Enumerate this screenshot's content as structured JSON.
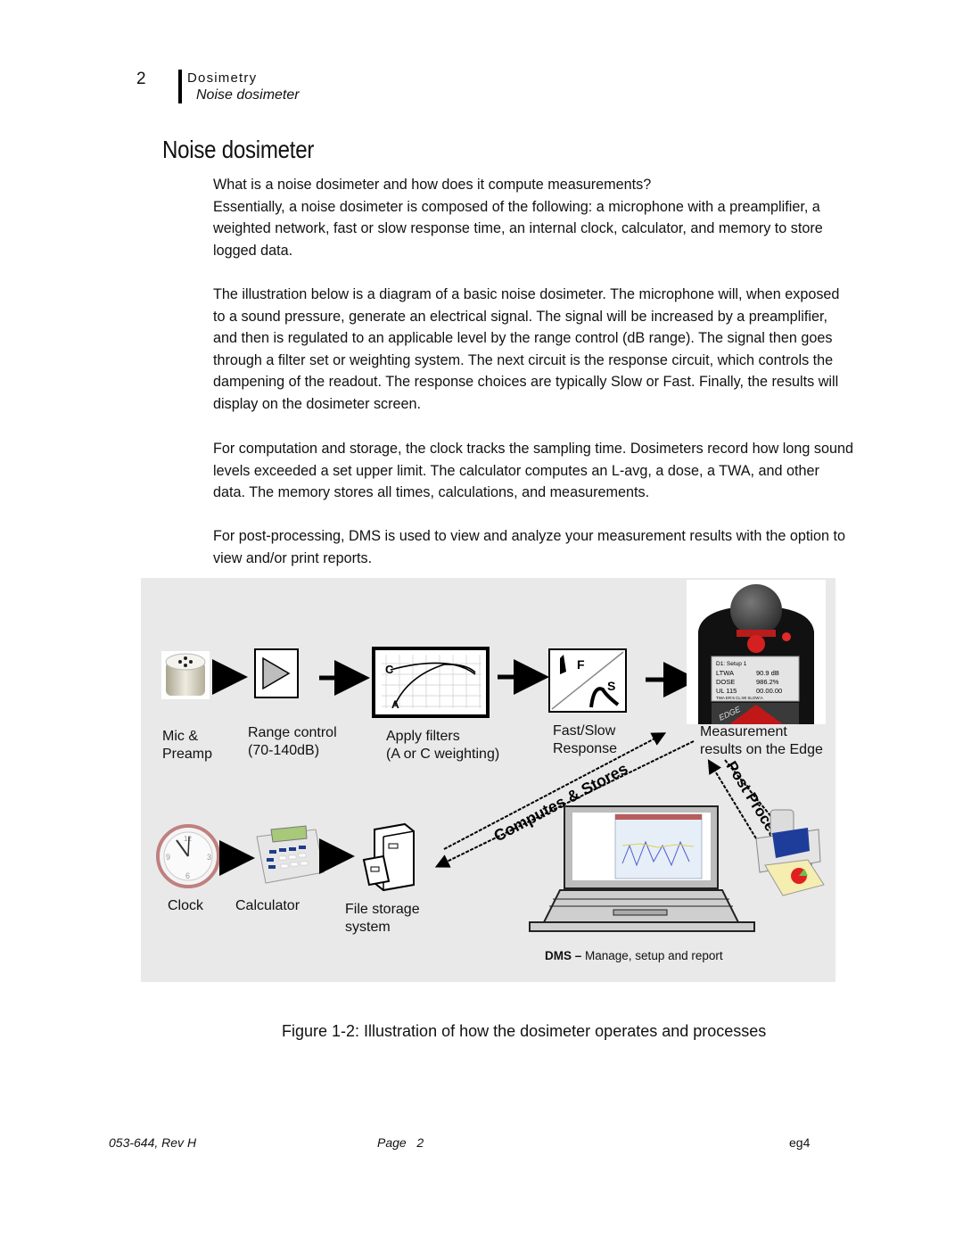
{
  "header": {
    "chapter_number": "2",
    "chapter_title": "Dosimetry",
    "section_title": "Noise dosimeter"
  },
  "page_title": "Noise dosimeter",
  "paragraphs": [
    "What is a noise dosimeter and how does it compute measurements? Essentially, a noise dosimeter is composed of the following:   a microphone with a preamplifier, a weighted network, fast or slow response time, an internal clock, calculator, and memory to store logged data.",
    "The illustration below is a diagram of a basic noise dosimeter.  The microphone will, when exposed to a sound pressure, generate an electrical signal.  The signal will be increased by a preamplifier, and then is regulated to an applicable level by the range control (dB range). The signal then goes through a filter set or weighting system.  The next circuit is the response circuit, which controls the dampening of the readout.  The response choices are typically Slow or Fast.  Finally, the results will display on the dosimeter screen.",
    "For computation and storage, the clock tracks the sampling time.  Dosimeters record how long sound levels exceeded a set upper limit.  The calculator computes an L-avg, a dose, a TWA, and other data.  The memory stores all times, calculations, and measurements.",
    "For post-processing, DMS is used to view and analyze your measurement results with the option to view and/or print reports."
  ],
  "intro_question": "What is a noise dosimeter and how does it compute measurements?",
  "intro_body": "Essentially, a noise dosimeter is composed of the following:   a microphone with a preamplifier, a weighted network, fast or slow response time, an internal clock, calculator, and memory to store logged data.",
  "diagram": {
    "labels": {
      "mic": [
        "Mic &",
        "Preamp"
      ],
      "range": [
        "Range control",
        "(70-140dB)"
      ],
      "filters": [
        "Apply filters",
        "(A or C weighting)"
      ],
      "response": [
        "Fast/Slow",
        "Response"
      ],
      "measurement": [
        "Measurement",
        "results on the Edge"
      ],
      "clock": "Clock",
      "calculator": "Calculator",
      "storage": [
        "File storage",
        "system"
      ],
      "dms_bold": "DMS –",
      "dms_rest": " Manage, setup and report",
      "computes_stores": "Computes & Stores",
      "post_processes": "Post Processes"
    },
    "filter_graph": {
      "curve_c": "C",
      "curve_a": "A"
    },
    "response_icon": {
      "fast": "F",
      "slow": "S"
    },
    "device_screen": {
      "header": "D1: Setup 1",
      "rows": [
        {
          "label": "LTWA",
          "value": "90.9 dB"
        },
        {
          "label": "DOSE",
          "value": "986.2%"
        },
        {
          "label": "UL 115",
          "value": "00.00.00"
        }
      ],
      "status": "TWA ER:5 CL:90 SLOW:A",
      "brand": "EDGE"
    },
    "clock_numbers": [
      "12",
      "3",
      "6",
      "9"
    ],
    "colors": {
      "panel_bg": "#e9e9e9",
      "device_red": "#d42020",
      "printer_blue": "#1e3c9a",
      "calc_screen": "#a8c87a"
    }
  },
  "figure_caption": "Figure 1-2:  Illustration of how the dosimeter operates and processes",
  "footer": {
    "doc_number": "053-644, Rev H",
    "page_label": "Page   2",
    "product": "eg4"
  }
}
